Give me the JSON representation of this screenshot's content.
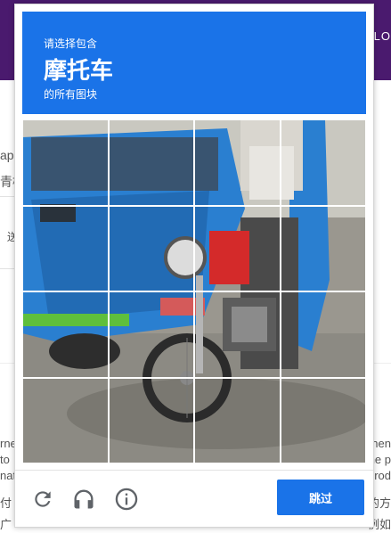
{
  "background": {
    "brand_text": "LLO",
    "left_snippets": [
      "ap",
      "青检",
      "送"
    ],
    "bottom_lines_left": [
      "rne",
      "to",
      "nat",
      "付",
      "广"
    ],
    "bottom_lines_right": [
      "nen",
      "ne p",
      "rod",
      "的方",
      "例如"
    ]
  },
  "captcha": {
    "header": {
      "line1": "请选择包含",
      "target": "摩托车",
      "line3": "的所有图块"
    },
    "grid": {
      "rows": 4,
      "cols": 4
    },
    "footer": {
      "skip_label": "跳过",
      "icons": [
        "reload-icon",
        "audio-icon",
        "info-icon"
      ]
    },
    "colors": {
      "accent": "#1a73e8",
      "topbar": "#4a1a6e"
    }
  }
}
